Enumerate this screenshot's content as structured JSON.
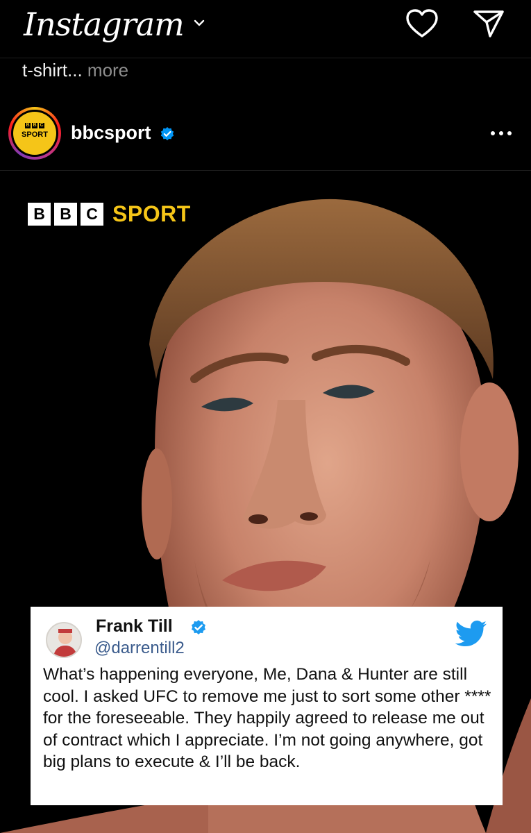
{
  "app": {
    "title": "Instagram"
  },
  "caption": {
    "text": "t-shirt...",
    "more_label": "more"
  },
  "post": {
    "username": "bbcsport",
    "avatar_label": "SPORT",
    "avatar_letters": [
      "B",
      "B",
      "C"
    ],
    "brand_letters": [
      "B",
      "B",
      "C"
    ],
    "brand_word": "SPORT"
  },
  "tweet": {
    "name": "Frank Till",
    "handle": "@darrentill2",
    "text": "What’s happening everyone, Me, Dana & Hunter are still cool. I asked UFC to remove me just to sort some other **** for the foreseeable. They happily agreed to release me out of contract which I appreciate. I’m not going anywhere, got big plans to execute & I’ll be back."
  },
  "icons": {
    "logo_dropdown": "chevron-down-icon",
    "notifications": "heart-icon",
    "messages": "send-icon",
    "verified": "verified-badge-icon",
    "post_menu": "more-horizontal-icon",
    "tweet_source": "twitter-bird-icon"
  },
  "colors": {
    "background": "#000000",
    "verified_blue": "#0095f6",
    "bbc_yellow": "#f5c518",
    "twitter_blue": "#1d9bf0",
    "muted_text": "#8e8e8e"
  }
}
